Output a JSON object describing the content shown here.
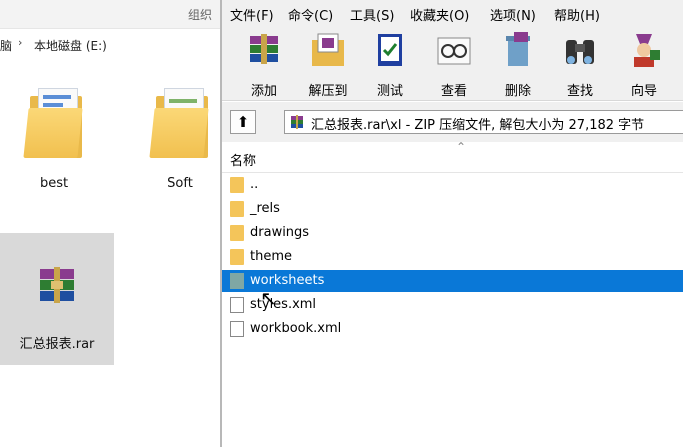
{
  "explorer": {
    "top_label": "组织",
    "address_seg1": "脑",
    "address_seg2": "本地磁盘 (E:)",
    "items": [
      {
        "label": "best"
      },
      {
        "label": "Soft"
      },
      {
        "label": "汇总报表.rar"
      }
    ]
  },
  "winrar": {
    "menu": [
      "文件(F)",
      "命令(C)",
      "工具(S)",
      "收藏夹(O)",
      "选项(N)",
      "帮助(H)"
    ],
    "toolbar": [
      "添加",
      "解压到",
      "测试",
      "查看",
      "删除",
      "查找",
      "向导"
    ],
    "path": "汇总报表.rar\\xl - ZIP 压缩文件, 解包大小为 27,182 字节",
    "column_name": "名称",
    "files": [
      {
        "name": "..",
        "kind": "folder"
      },
      {
        "name": "_rels",
        "kind": "folder"
      },
      {
        "name": "drawings",
        "kind": "folder"
      },
      {
        "name": "theme",
        "kind": "folder"
      },
      {
        "name": "worksheets",
        "kind": "folder",
        "selected": true
      },
      {
        "name": "styles.xml",
        "kind": "file"
      },
      {
        "name": "workbook.xml",
        "kind": "file"
      }
    ]
  },
  "colors": {
    "selection": "#0a78d7",
    "folder": "#f4c55a"
  }
}
